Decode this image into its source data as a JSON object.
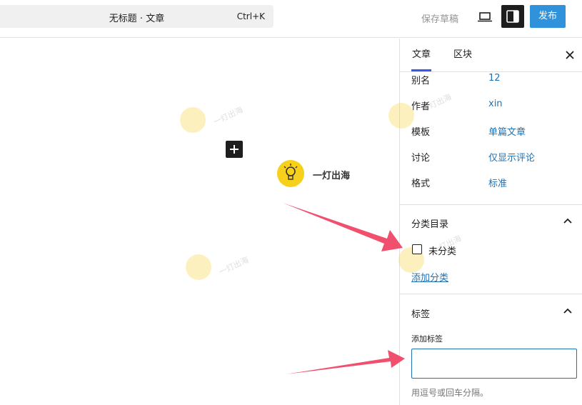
{
  "topbar": {
    "doc_title": "无标题 · 文章",
    "shortcut": "Ctrl+K",
    "save_draft": "保存草稿",
    "publish": "发布"
  },
  "canvas": {
    "brand_name": "一灯出海",
    "watermark_text": "一灯出海"
  },
  "sidebar": {
    "tabs": [
      {
        "label": "文章"
      },
      {
        "label": "区块"
      }
    ],
    "meta": [
      {
        "key": "别名",
        "value": "12"
      },
      {
        "key": "作者",
        "value": "xin"
      },
      {
        "key": "模板",
        "value": "单篇文章"
      },
      {
        "key": "讨论",
        "value": "仅显示评论"
      },
      {
        "key": "格式",
        "value": "标准"
      }
    ],
    "categories": {
      "title": "分类目录",
      "items": [
        {
          "label": "未分类",
          "checked": false
        }
      ],
      "add_link": "添加分类"
    },
    "tags": {
      "title": "标签",
      "input_label": "添加标签",
      "input_value": "",
      "help": "用逗号或回车分隔。"
    }
  },
  "colors": {
    "accent": "#3858e9",
    "link": "#2271b1",
    "publish": "#0b7fd4",
    "brand_yellow": "#f6d01b",
    "annotation_arrow": "#f0506e"
  }
}
